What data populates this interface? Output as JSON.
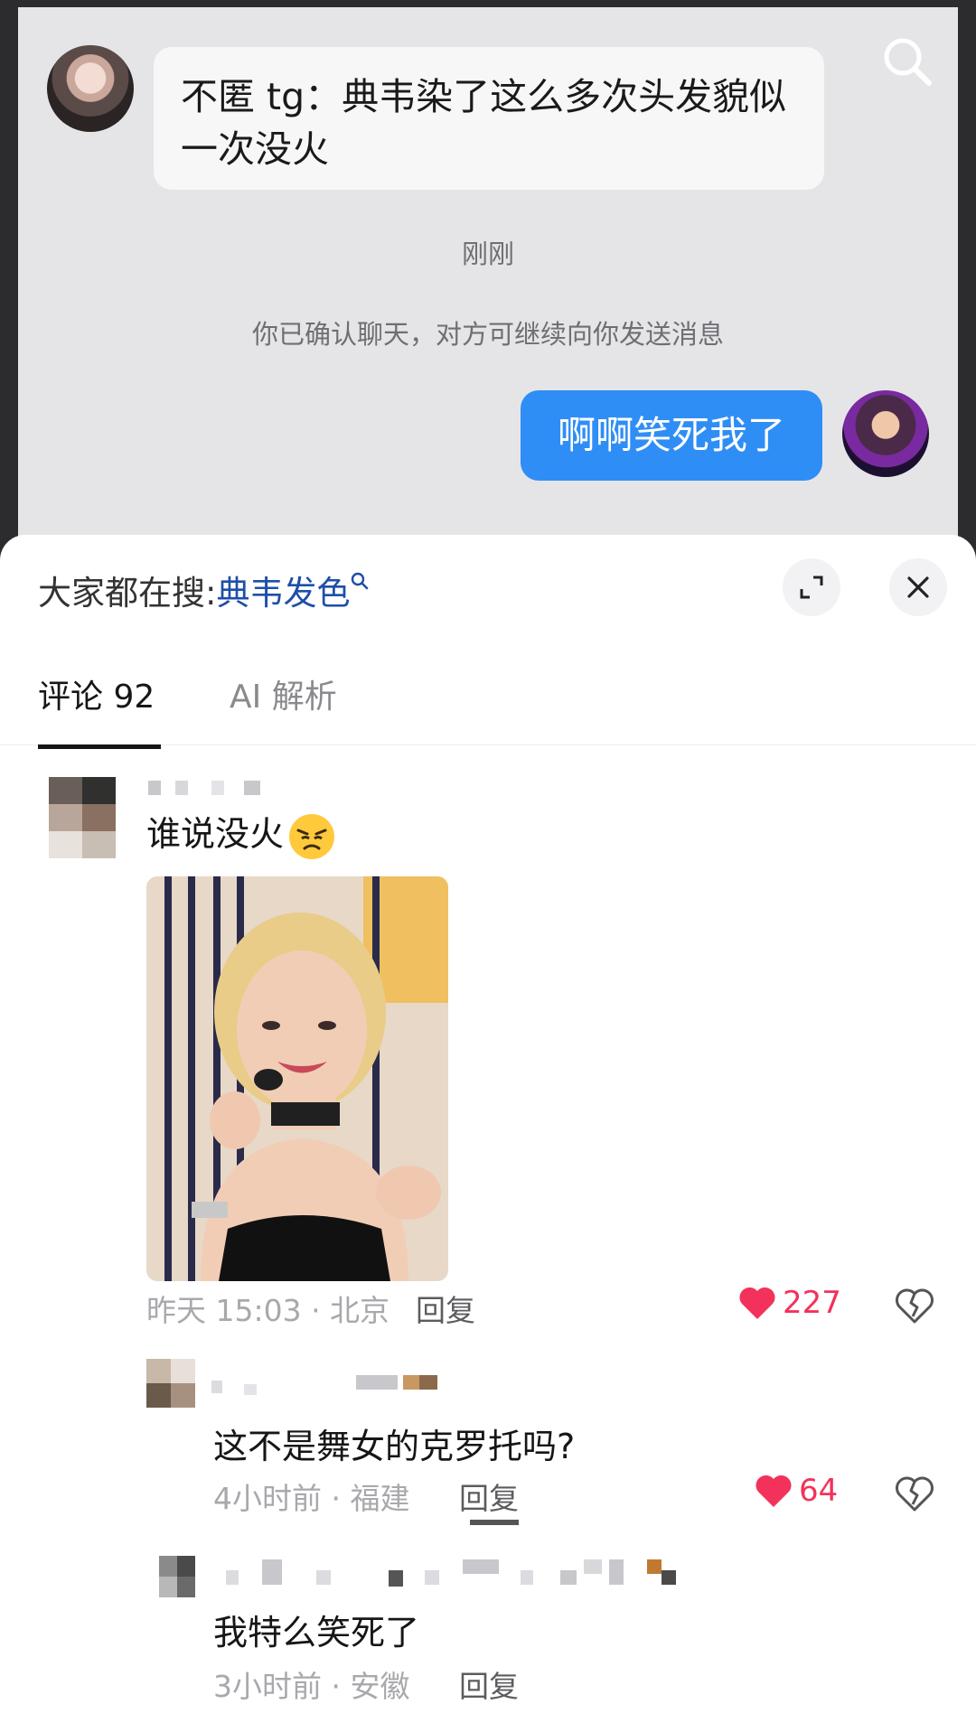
{
  "chat": {
    "incoming_message": "不匿 tg：典韦染了这么多次头发貌似一次没火",
    "timestamp": "刚刚",
    "notice": "你已确认聊天，对方可继续向你发送消息",
    "outgoing_message": "啊啊笑死我了",
    "search_icon": "search-icon"
  },
  "sheet": {
    "hot_search_prefix": "大家都在搜:",
    "hot_search_keyword": "典韦发色",
    "expand_icon": "expand-icon",
    "close_icon": "close-icon",
    "tabs": [
      {
        "label": "评论 92",
        "active": true
      },
      {
        "label": "AI 解析",
        "active": false
      }
    ]
  },
  "comments": [
    {
      "text": "谁说没火",
      "emoji": "angry-face-emoji",
      "meta": "昨天 15:03 · 北京",
      "reply": "回复",
      "likes": "227"
    },
    {
      "text": "这不是舞女的克罗托吗?",
      "meta": "4小时前 · 福建",
      "reply": "回复",
      "likes": "64"
    },
    {
      "text": "我特么笑死了",
      "meta": "3小时前 · 安徽",
      "reply": "回复"
    }
  ],
  "colors": {
    "bubble_out": "#2f8ef5",
    "like_red": "#f2325a",
    "keyword_blue": "#1e4fa8"
  }
}
